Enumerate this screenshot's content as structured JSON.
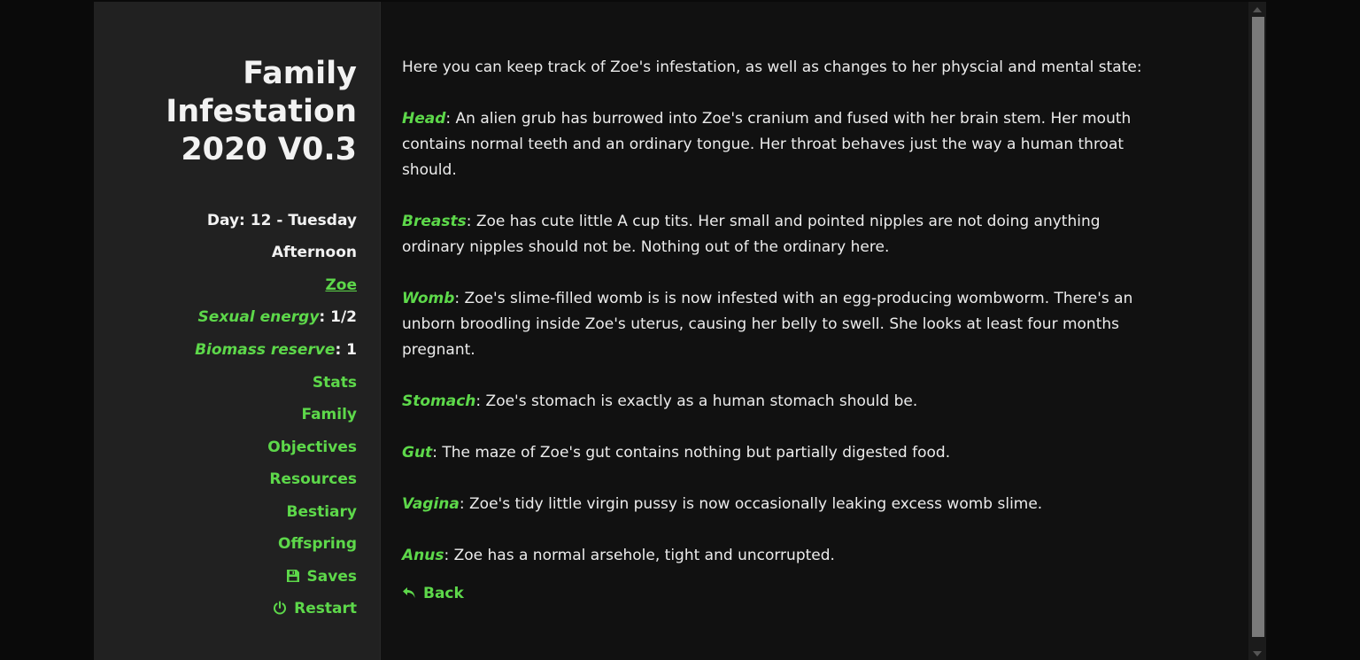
{
  "app": {
    "title": "Family Infestation 2020 V0.3"
  },
  "sidebar": {
    "day": "Day: 12 - Tuesday",
    "time_of_day": "Afternoon",
    "character": "Zoe",
    "sexual_energy": {
      "label": "Sexual energy",
      "value": ": 1/2"
    },
    "biomass_reserve": {
      "label": "Biomass reserve",
      "value": ": 1"
    },
    "menu": [
      "Stats",
      "Family",
      "Objectives",
      "Resources",
      "Bestiary",
      "Offspring"
    ],
    "saves_label": "Saves",
    "restart_label": "Restart",
    "saves_icon": "floppy-disk-icon",
    "restart_icon": "power-icon"
  },
  "main": {
    "intro": "Here you can keep track of Zoe's infestation, as well as changes to her physcial and mental state:",
    "parts": [
      {
        "name": "Head",
        "text": ": An alien grub has burrowed into Zoe's cranium and fused with her brain stem. Her mouth contains normal teeth and an ordinary tongue. Her throat behaves just the way a human throat should."
      },
      {
        "name": "Breasts",
        "text": ": Zoe has cute little A cup tits. Her small and pointed nipples are not doing anything ordinary nipples should not be. Nothing out of the ordinary here."
      },
      {
        "name": "Womb",
        "text": ": Zoe's slime-filled womb is is now infested with an egg-producing wombworm. There's an unborn broodling inside Zoe's uterus, causing her belly to swell. She looks at least four months pregnant."
      },
      {
        "name": "Stomach",
        "text": ": Zoe's stomach is exactly as a human stomach should be."
      },
      {
        "name": "Gut",
        "text": ": The maze of Zoe's gut contains nothing but partially digested food."
      },
      {
        "name": "Vagina",
        "text": ": Zoe's tidy little virgin pussy is now occasionally leaking excess womb slime."
      },
      {
        "name": "Anus",
        "text": ": Zoe has a normal arsehole, tight and uncorrupted."
      }
    ],
    "back_label": "Back",
    "back_icon": "back-arrow-icon"
  },
  "colors": {
    "accent": "#5dd84a",
    "sidebar_bg": "#212121",
    "main_bg": "#111111",
    "text": "#ececec"
  }
}
